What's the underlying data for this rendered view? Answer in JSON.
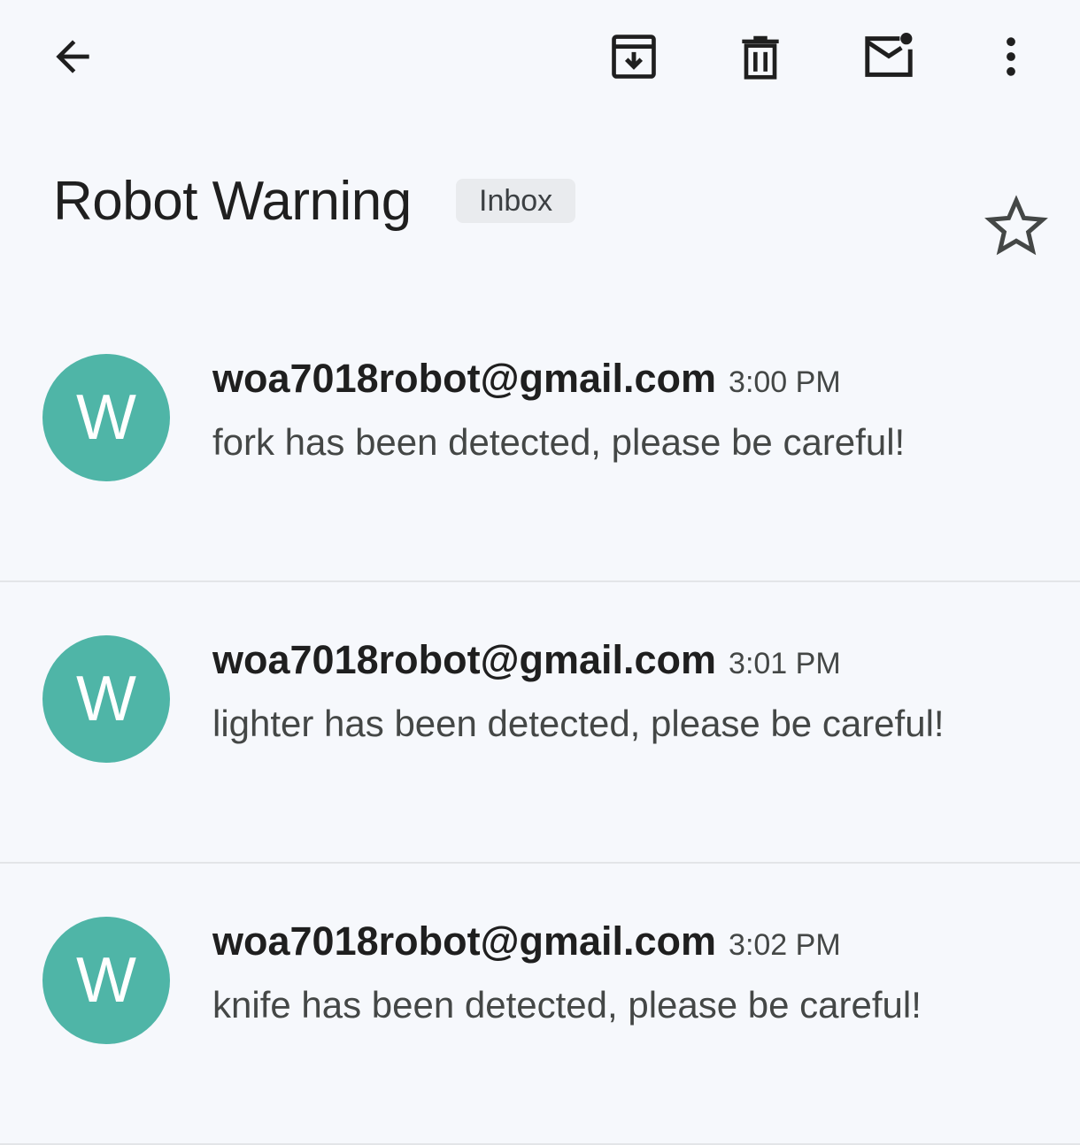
{
  "toolbar": {
    "back_icon": "arrow-left-icon",
    "archive_icon": "archive-icon",
    "delete_icon": "trash-icon",
    "mark_unread_icon": "mail-unread-icon",
    "more_icon": "more-vert-icon"
  },
  "thread": {
    "subject": "Robot Warning",
    "label": "Inbox",
    "star_icon": "star-outline-icon"
  },
  "messages": [
    {
      "avatar_letter": "W",
      "sender": "woa7018robot@gmail.com",
      "time": "3:00 PM",
      "snippet": "fork has been detected, please be careful!"
    },
    {
      "avatar_letter": "W",
      "sender": "woa7018robot@gmail.com",
      "time": "3:01 PM",
      "snippet": "lighter has been detected, please be careful!"
    },
    {
      "avatar_letter": "W",
      "sender": "woa7018robot@gmail.com",
      "time": "3:02 PM",
      "snippet": "knife has been detected, please be careful!"
    }
  ],
  "colors": {
    "background": "#f6f8fc",
    "avatar": "#4fb5a7",
    "chip": "#e9ebee",
    "divider": "#e3e5e8"
  }
}
